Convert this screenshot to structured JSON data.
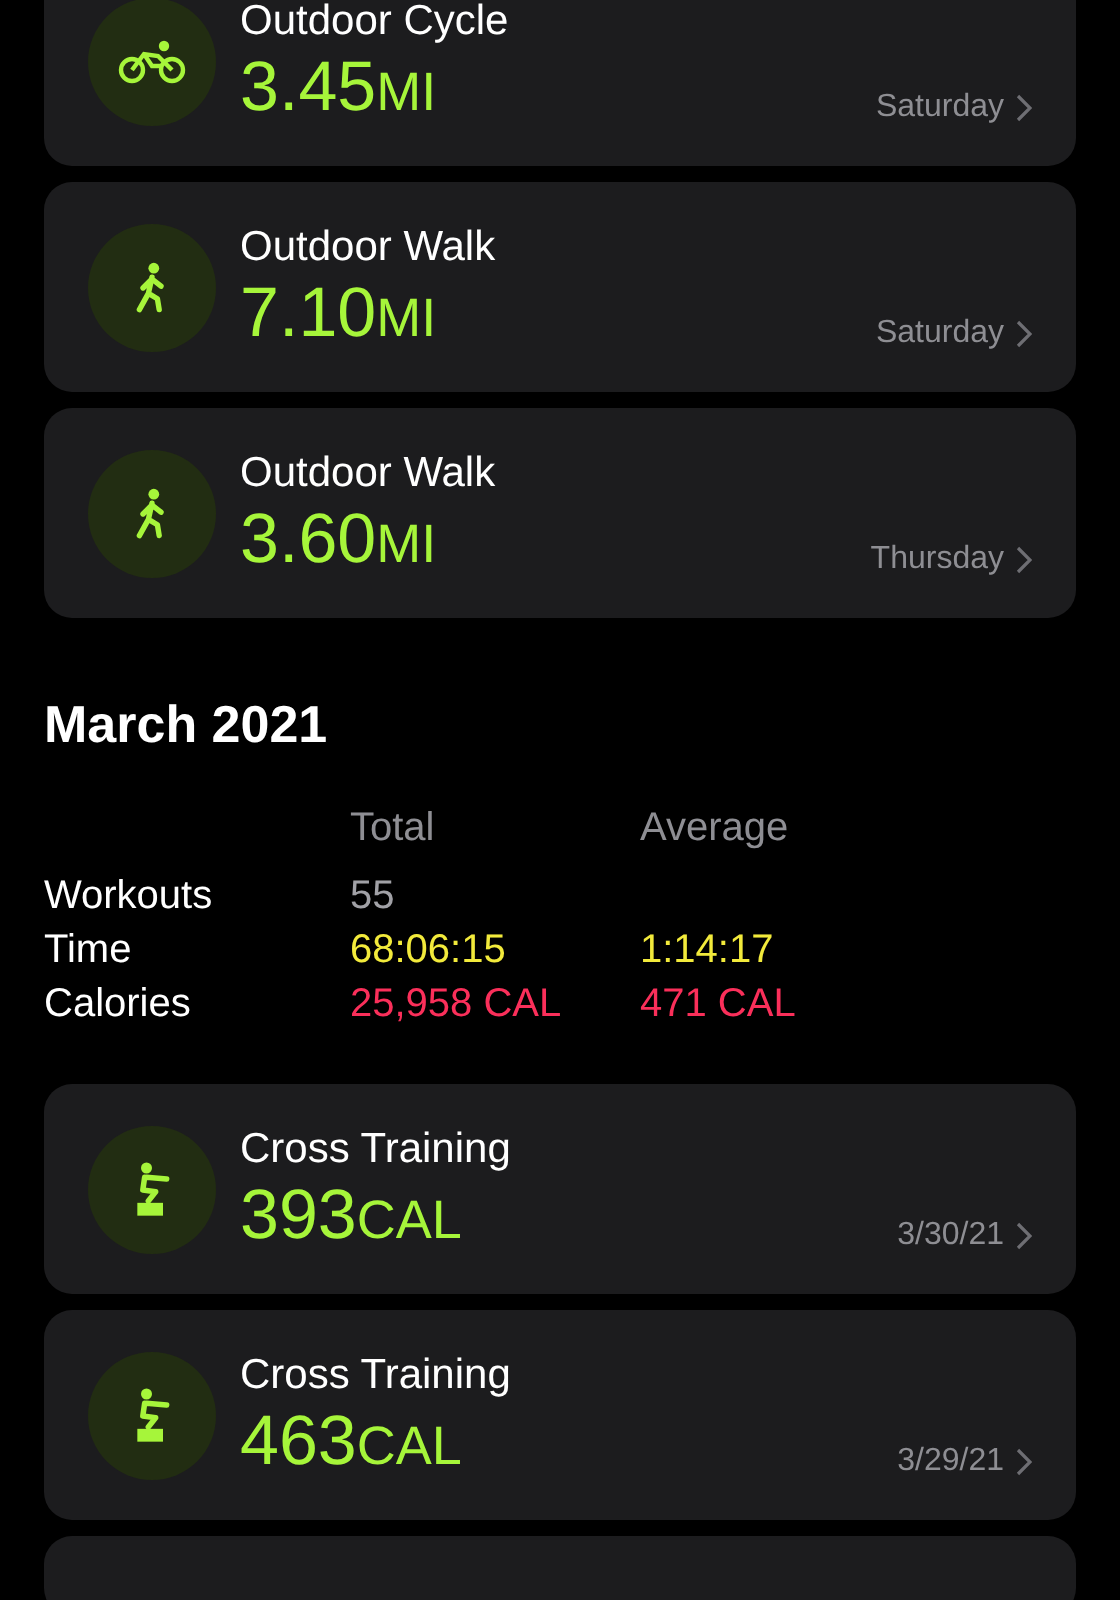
{
  "top_workouts": [
    {
      "kind": "cycle",
      "name": "Outdoor Cycle",
      "value": "3.45",
      "unit": "MI",
      "date": "Saturday"
    },
    {
      "kind": "walk",
      "name": "Outdoor Walk",
      "value": "7.10",
      "unit": "MI",
      "date": "Saturday"
    },
    {
      "kind": "walk",
      "name": "Outdoor Walk",
      "value": "3.60",
      "unit": "MI",
      "date": "Thursday"
    }
  ],
  "month": {
    "title": "March 2021",
    "columns": [
      "Total",
      "Average"
    ],
    "rows": [
      {
        "kind": "count",
        "label": "Workouts",
        "total": "55"
      },
      {
        "kind": "time",
        "label": "Time",
        "total": "68:06:15",
        "average": "1:14:17"
      },
      {
        "kind": "calories",
        "label": "Calories",
        "total": "25,958 CAL",
        "average": "471 CAL"
      }
    ],
    "workouts": [
      {
        "kind": "cross",
        "name": "Cross Training",
        "value": "393",
        "unit": "CAL",
        "date": "3/30/21"
      },
      {
        "kind": "cross",
        "name": "Cross Training",
        "value": "463",
        "unit": "CAL",
        "date": "3/29/21"
      }
    ],
    "more_below": true
  }
}
